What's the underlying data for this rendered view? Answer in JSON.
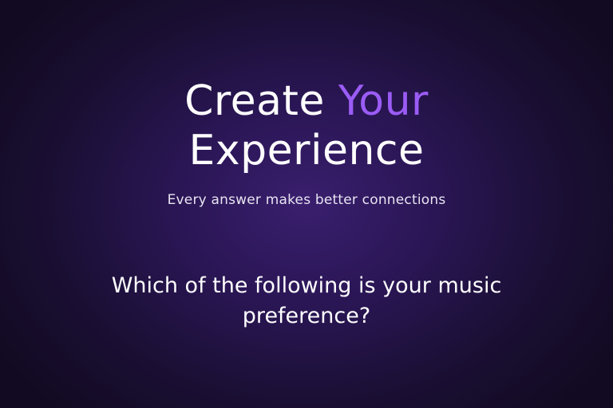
{
  "hero": {
    "title_part1": "Create",
    "title_accent": "Your",
    "title_part2": "Experience",
    "subtitle": "Every answer makes better connections"
  },
  "question": {
    "text": "Which of the following is your music preference?"
  },
  "colors": {
    "accent": "#9b5cf6",
    "background": "#2a1655",
    "text": "#ffffff"
  }
}
